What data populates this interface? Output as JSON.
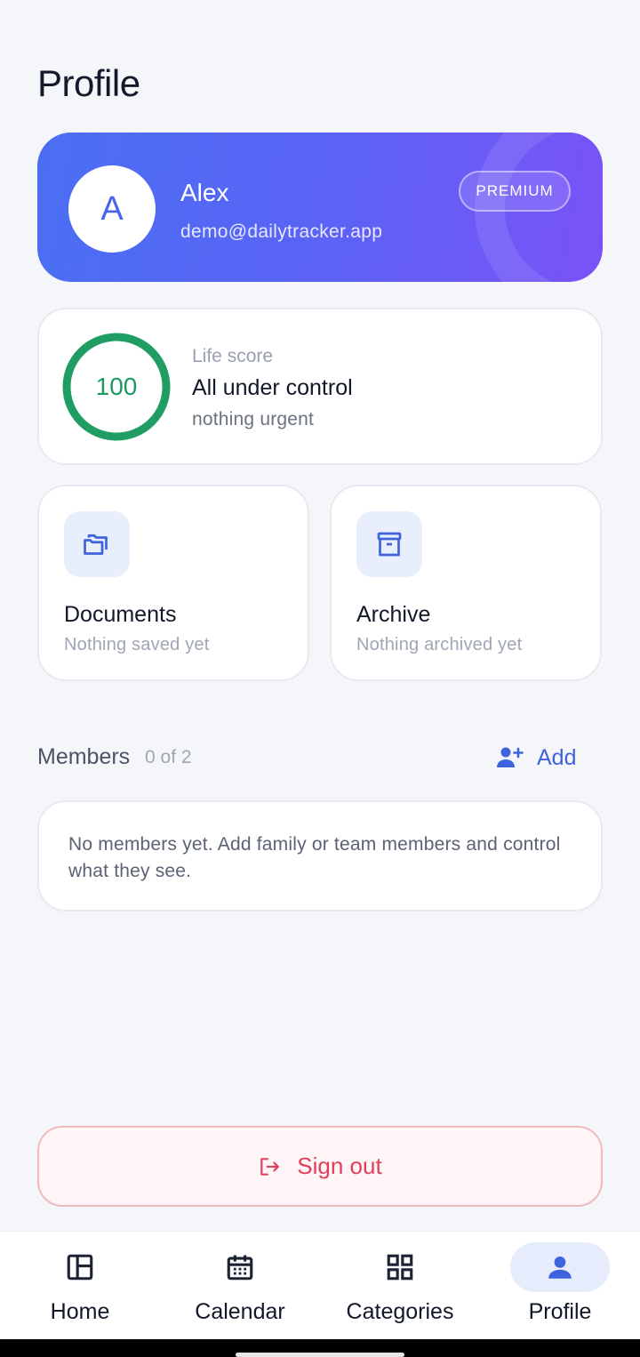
{
  "page": {
    "title": "Profile"
  },
  "profile": {
    "avatar_initial": "A",
    "name": "Alex",
    "email": "demo@dailytracker.app",
    "badge": "PREMIUM"
  },
  "life_score": {
    "value": "100",
    "label": "Life score",
    "title": "All under control",
    "subtitle": "nothing urgent",
    "ring_color": "#1f9d63"
  },
  "tiles": [
    {
      "title": "Documents",
      "subtitle": "Nothing saved yet",
      "icon": "folder-icon"
    },
    {
      "title": "Archive",
      "subtitle": "Nothing archived yet",
      "icon": "archive-icon"
    }
  ],
  "members": {
    "title": "Members",
    "count": "0 of 2",
    "add_label": "Add",
    "empty_text": "No members yet. Add family or team members and control what they see."
  },
  "signout": {
    "label": "Sign out",
    "color": "#e0405a"
  },
  "nav": [
    {
      "label": "Home",
      "icon": "home-layout-icon"
    },
    {
      "label": "Calendar",
      "icon": "calendar-icon"
    },
    {
      "label": "Categories",
      "icon": "grid-icon"
    },
    {
      "label": "Profile",
      "icon": "person-icon",
      "active": true
    }
  ],
  "colors": {
    "accent": "#3f63dc",
    "background": "#f5f6fa"
  }
}
